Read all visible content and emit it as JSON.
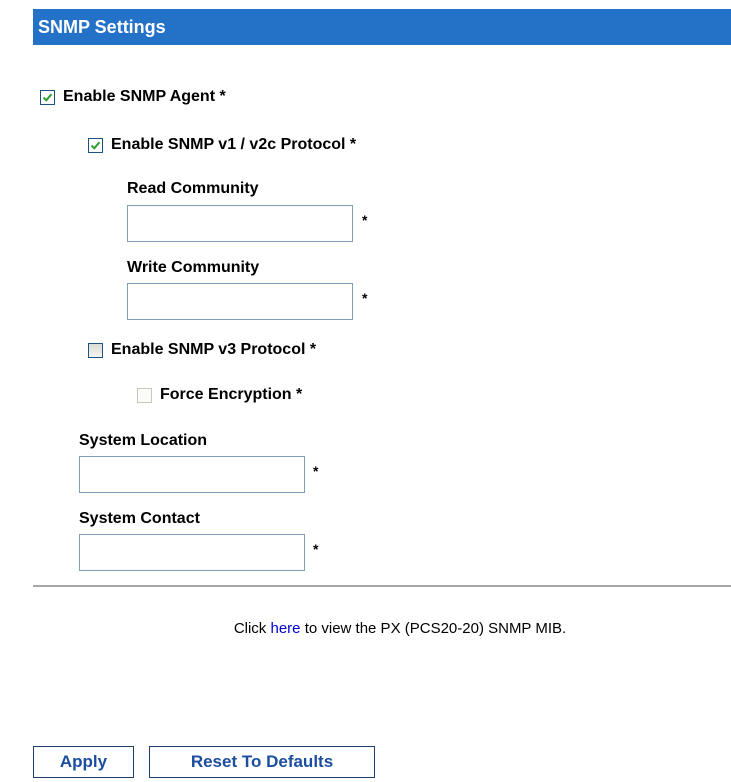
{
  "header": {
    "title": "SNMP Settings"
  },
  "form": {
    "enable_agent": {
      "label": "Enable SNMP Agent *",
      "checked": true
    },
    "enable_v1v2c": {
      "label": "Enable SNMP v1 / v2c Protocol *",
      "checked": true
    },
    "read_community": {
      "label": "Read Community",
      "value": "",
      "required_mark": "*"
    },
    "write_community": {
      "label": "Write Community",
      "value": "",
      "required_mark": "*"
    },
    "enable_v3": {
      "label": "Enable SNMP v3 Protocol *",
      "checked": false
    },
    "force_encryption": {
      "label": "Force Encryption *",
      "checked": false,
      "disabled": true
    },
    "system_location": {
      "label": "System Location",
      "value": "",
      "required_mark": "*"
    },
    "system_contact": {
      "label": "System Contact",
      "value": "",
      "required_mark": "*"
    }
  },
  "mib_note": {
    "prefix": "Click",
    "link": "here",
    "suffix": "to view the PX (PCS20-20) SNMP MIB."
  },
  "buttons": {
    "apply": "Apply",
    "reset": "Reset To Defaults"
  },
  "colors": {
    "header_bg": "#2471c8",
    "link": "#0000cc",
    "check": "#2e9c2e"
  },
  "icons": {
    "checkmark": "checkmark-icon"
  }
}
